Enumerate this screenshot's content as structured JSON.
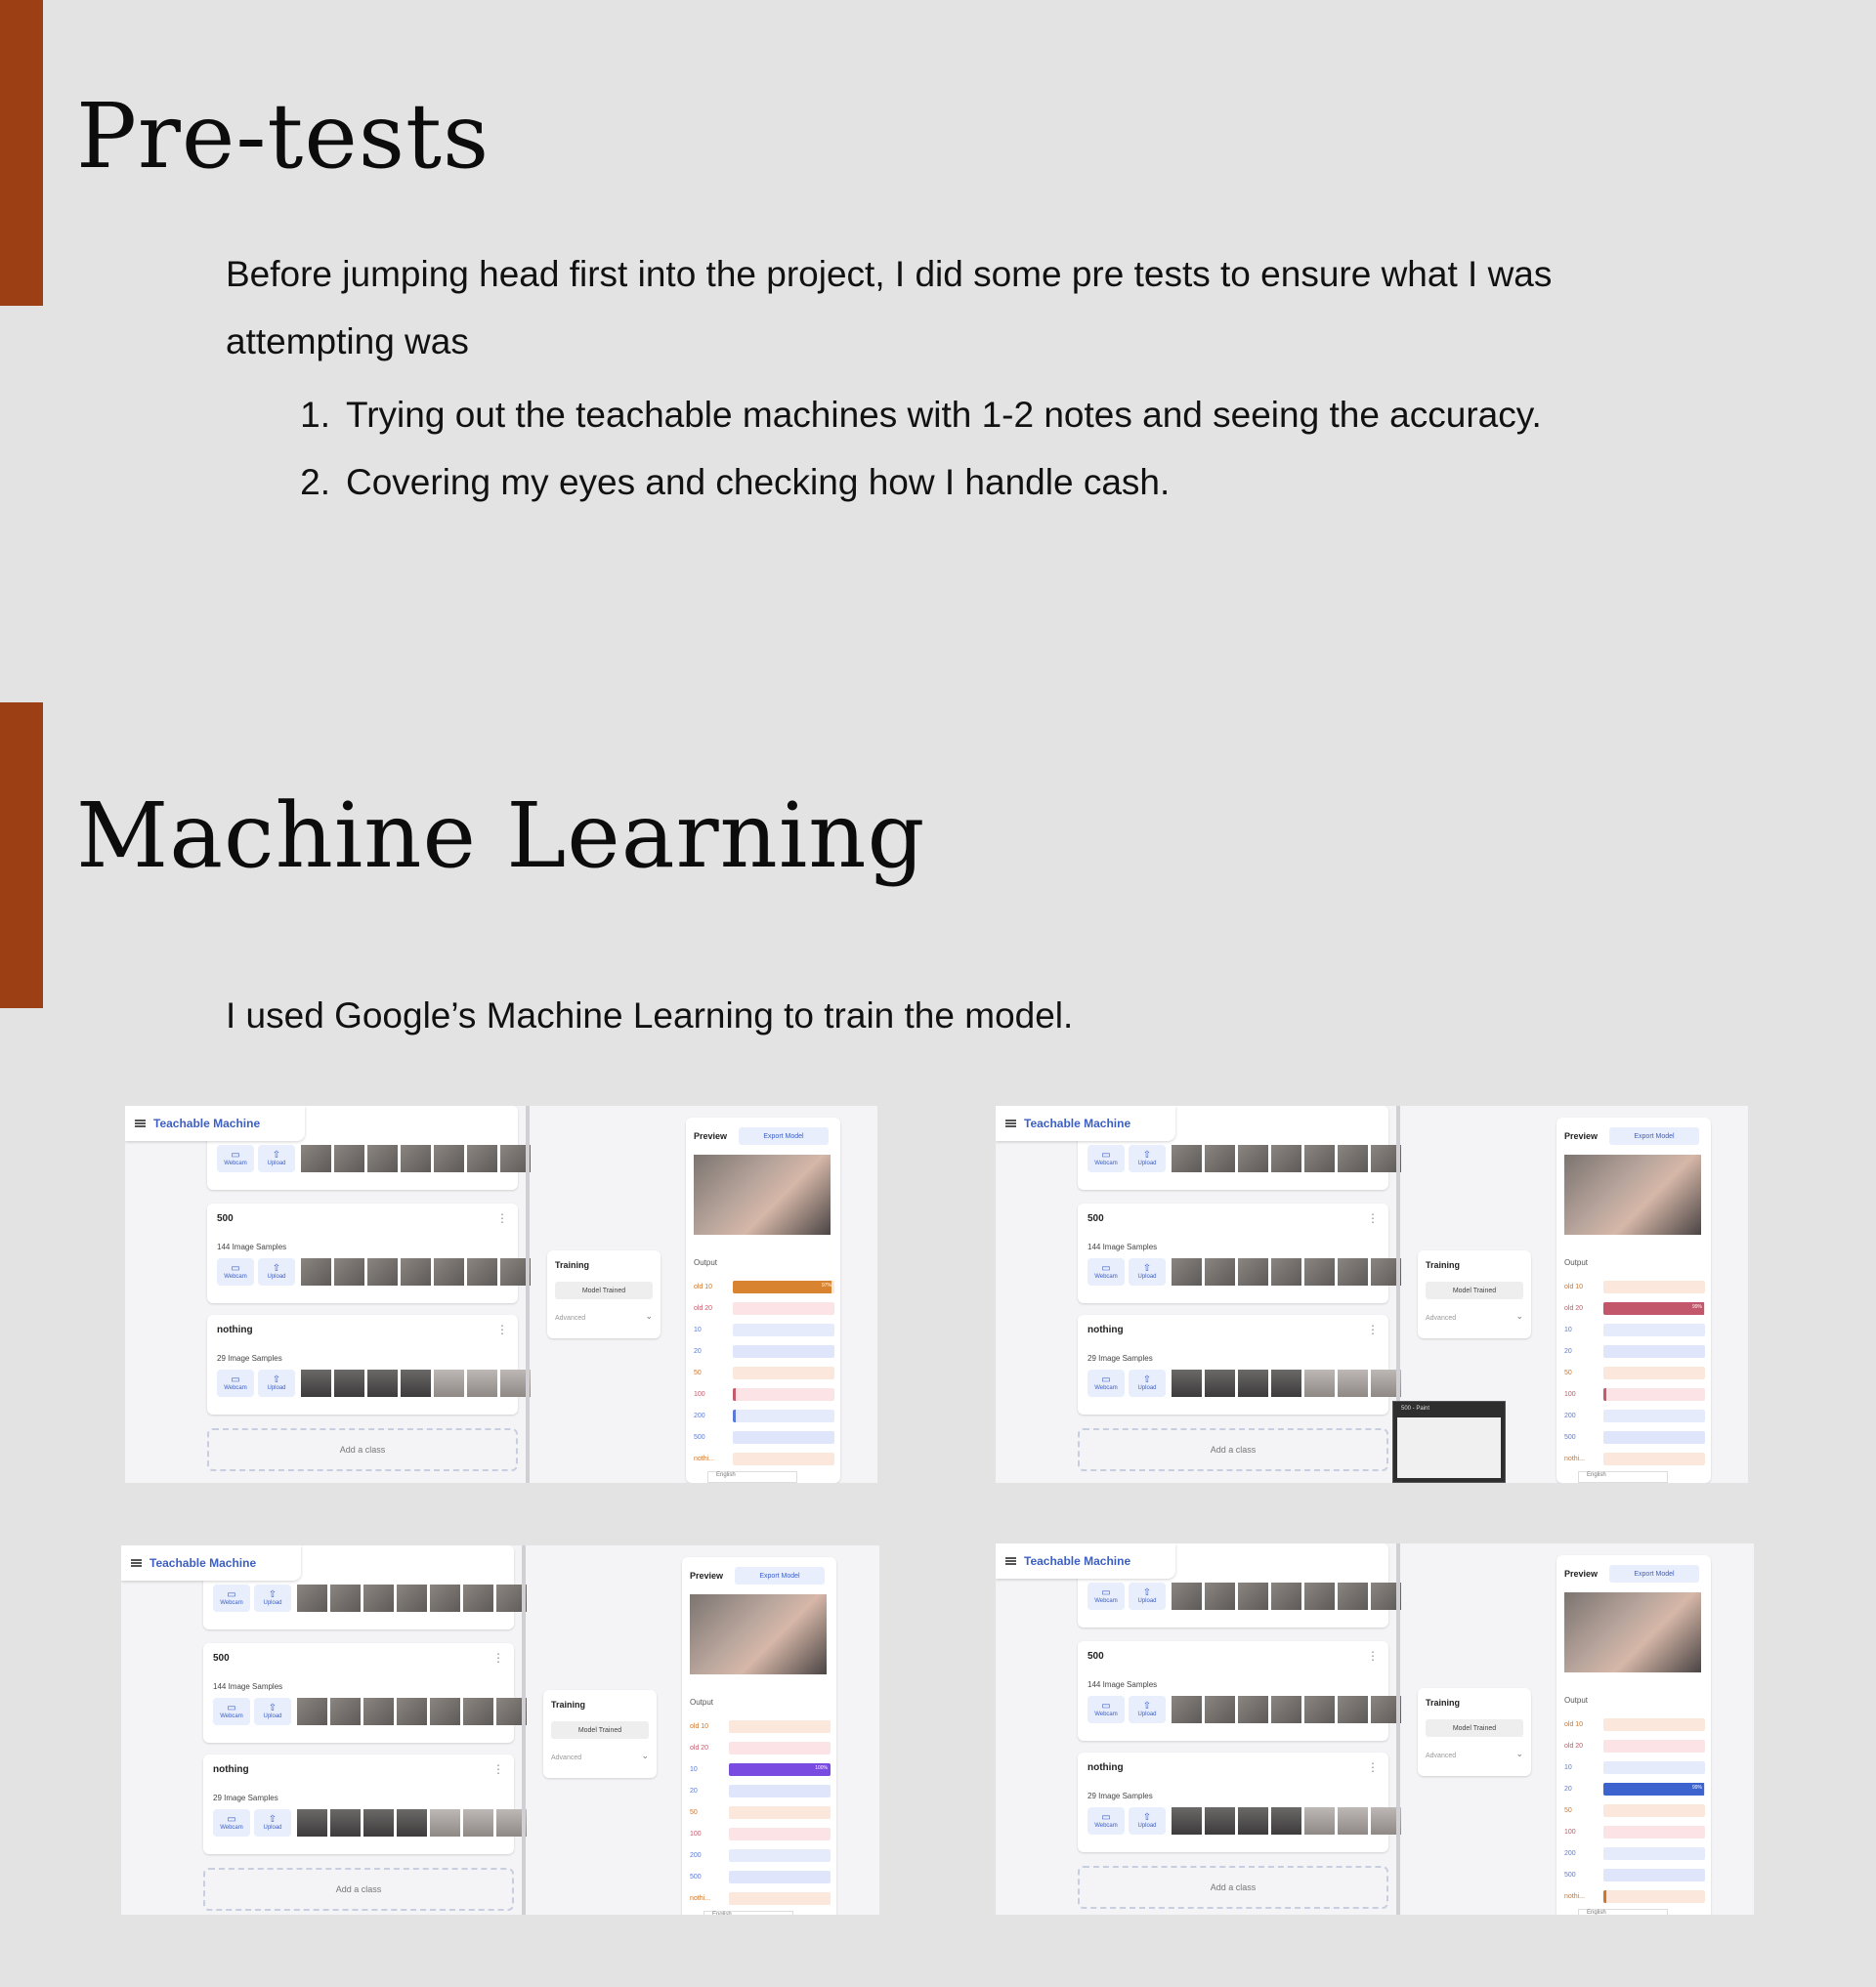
{
  "section1": {
    "heading": "Pre-tests",
    "intro": "Before jumping head first into the project, I did some pre tests to ensure what I was attempting was",
    "list": [
      {
        "num": "1.",
        "text": "Trying out the teachable machines with 1-2 notes and seeing the accuracy."
      },
      {
        "num": "2.",
        "text": "Covering my eyes and checking how I handle cash."
      }
    ]
  },
  "section2": {
    "heading": "Machine Learning",
    "body": "I used Google’s Machine Learning to train the model."
  },
  "screenshot_common": {
    "app_title": "Teachable Machine",
    "webcam_label": "Webcam",
    "upload_label": "Upload",
    "class_500": "500",
    "class_500_samples": "144 Image Samples",
    "class_nothing": "nothing",
    "class_nothing_samples": "29 Image Samples",
    "add_class": "Add a class",
    "training_title": "Training",
    "model_trained": "Model Trained",
    "advanced": "Advanced",
    "preview_title": "Preview",
    "export_model": "Export Model",
    "output_label": "Output",
    "language": "English",
    "paint_label": "500 - Paint"
  },
  "outputs": {
    "labels": [
      "old 10",
      "old 20",
      "10",
      "20",
      "50",
      "100",
      "200",
      "500",
      "nothi..."
    ],
    "label_colors": [
      "#d0752a",
      "#c45a6a",
      "#5b79d8",
      "#5b79d8",
      "#d0752a",
      "#c45a6a",
      "#5b79d8",
      "#5b79d8",
      "#d0752a"
    ],
    "track_colors": [
      "#fbe7dc",
      "#fbe3e6",
      "#e6ebfb",
      "#dfe6fb",
      "#fbe7dc",
      "#fbe3e6",
      "#e6ebfb",
      "#dfe6fb",
      "#fbe7dc"
    ],
    "shot1": {
      "values": [
        0.97,
        0,
        0,
        0,
        0,
        0.03,
        0.01,
        0,
        0
      ],
      "active": 0,
      "active_color": "#d8832f",
      "pct": "97%"
    },
    "shot2": {
      "values": [
        0,
        0.99,
        0,
        0,
        0,
        0.01,
        0,
        0,
        0
      ],
      "active": 1,
      "active_color": "#c2566a",
      "pct": "99%"
    },
    "shot3": {
      "values": [
        0,
        0,
        1.0,
        0,
        0,
        0,
        0,
        0,
        0
      ],
      "active": 2,
      "active_color": "#7a4be0",
      "pct": "100%"
    },
    "shot4": {
      "values": [
        0,
        0,
        0,
        0.99,
        0,
        0,
        0,
        0,
        0.01
      ],
      "active": 3,
      "active_color": "#3d63cf",
      "pct": "99%"
    }
  }
}
